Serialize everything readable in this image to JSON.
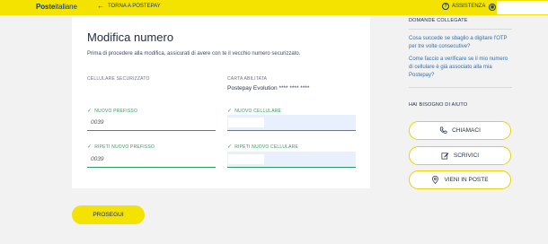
{
  "header": {
    "logo_bold": "Poste",
    "logo_rest": "italiane",
    "back_label": "TORNA A POSTEPAY",
    "help_label": "ASSISTENZA"
  },
  "form": {
    "title": "Modifica numero",
    "intro": "Prima di procedere alla modifica, assicurati di avere con te il vecchio numero securizzato.",
    "secured_phone_label": "CELLULARE SECURIZZATO",
    "card_label": "CARTA ABILITATA",
    "card_value": "Postepay Evolution **** **** ****",
    "new_prefix_label": "NUOVO PREFISSO",
    "new_prefix_value": "0039",
    "new_phone_label": "NUOVO CELLULARE",
    "repeat_prefix_label": "RIPETI NUOVO PREFISSO",
    "repeat_prefix_value": "0039",
    "repeat_phone_label": "RIPETI NUOVO CELLULARE",
    "submit_label": "PROSEGUI"
  },
  "sidebar": {
    "faq_heading": "DOMANDE COLLEGATE",
    "faq_links": [
      "Cosa succede se sbaglio a digitare l'OTP per tre volte consecutive?",
      "Come faccio a verificare se il mio numero di cellulare è già associato alla mia Postepay?"
    ],
    "help_heading": "HAI BISOGNO DI AIUTO",
    "buttons": [
      "CHIAMACI",
      "SCRIVICI",
      "VIENI IN POSTE"
    ]
  },
  "colors": {
    "brand_yellow": "#f4e200",
    "brand_blue": "#0b3a8c",
    "valid_green": "#2a9d5c",
    "link_blue": "#2f6fb3"
  }
}
